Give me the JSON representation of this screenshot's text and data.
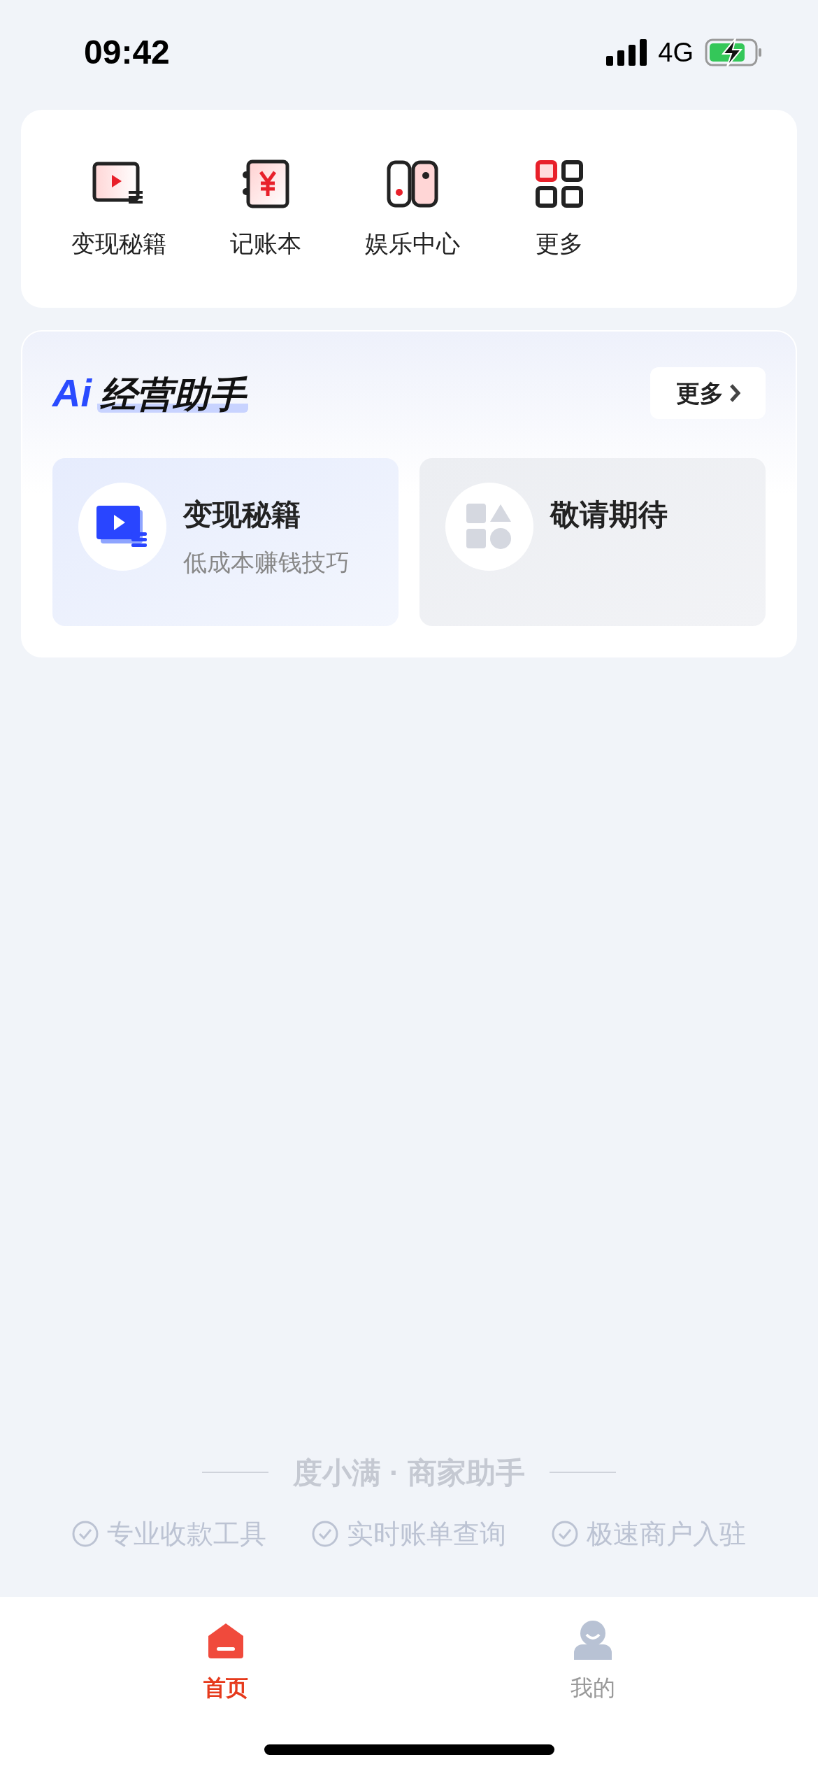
{
  "status_bar": {
    "time": "09:42",
    "network": "4G"
  },
  "shortcuts": [
    {
      "kind": "video",
      "label": "变现秘籍"
    },
    {
      "kind": "ledger",
      "label": "记账本"
    },
    {
      "kind": "game",
      "label": "娱乐中心"
    },
    {
      "kind": "grid",
      "label": "更多"
    }
  ],
  "assistant": {
    "logo_mark": "Ai",
    "title": "经营助手",
    "more_button": "更多",
    "cards": [
      {
        "kind": "video",
        "title": "变现秘籍",
        "subtitle": "低成本赚钱技巧"
      },
      {
        "kind": "shapes",
        "title": "敬请期待"
      }
    ]
  },
  "footer": {
    "brand": "度小满 · 商家助手",
    "features": [
      "专业收款工具",
      "实时账单查询",
      "极速商户入驻"
    ]
  },
  "tab_bar": [
    {
      "kind": "home",
      "label": "首页",
      "selected": true
    },
    {
      "kind": "profile",
      "label": "我的",
      "selected": false
    }
  ]
}
